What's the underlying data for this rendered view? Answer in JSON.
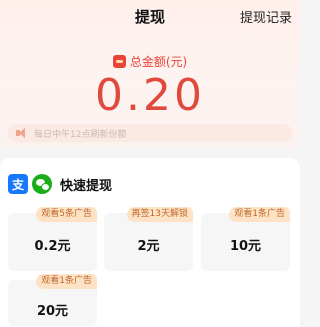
{
  "header": {
    "title": "提现",
    "record_link": "提现记录"
  },
  "balance": {
    "label": "总金额(元)",
    "amount": "0.20"
  },
  "notice": {
    "text": "每日中午12点刷新份额"
  },
  "withdraw": {
    "title": "快速提现",
    "methods": [
      "alipay-icon",
      "wechat-icon"
    ],
    "options": [
      {
        "badge": "观看5条广告",
        "value": "0.2元"
      },
      {
        "badge": "再签13天解锁",
        "value": "2元"
      },
      {
        "badge": "观看1条广告",
        "value": "10元"
      },
      {
        "badge": "观看1条广告",
        "value": "20元"
      }
    ]
  },
  "colors": {
    "accent": "#e04a3c",
    "badge_bg": "#fde2c6",
    "badge_text": "#c0692a",
    "alipay": "#1677ff",
    "wechat": "#1aad19"
  }
}
